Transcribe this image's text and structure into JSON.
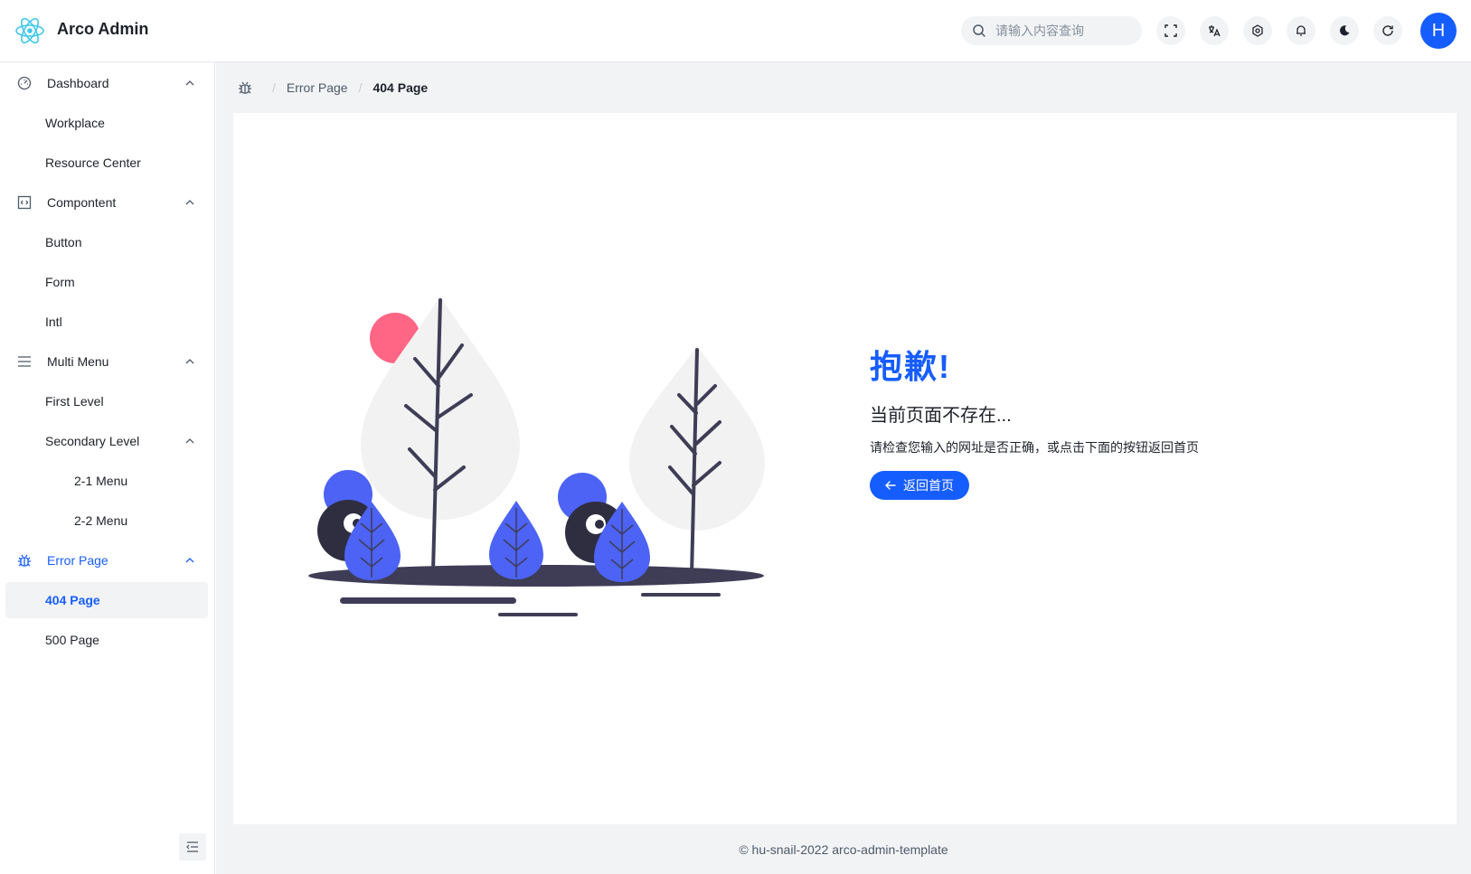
{
  "app": {
    "title": "Arco Admin"
  },
  "header": {
    "search_placeholder": "请输入内容查询",
    "avatar_letter": "H",
    "buttons": [
      "fullscreen-icon",
      "translate-icon",
      "settings-icon",
      "bell-icon",
      "moon-icon",
      "refresh-icon"
    ]
  },
  "sidebar": {
    "items": [
      {
        "label": "Dashboard",
        "icon": "dashboard-icon",
        "expanded": true
      },
      {
        "label": "Workplace"
      },
      {
        "label": "Resource Center"
      },
      {
        "label": "Compontent",
        "icon": "code-block-icon",
        "expanded": true
      },
      {
        "label": "Button"
      },
      {
        "label": "Form"
      },
      {
        "label": "Intl"
      },
      {
        "label": "Multi Menu",
        "icon": "menu-icon",
        "expanded": true
      },
      {
        "label": "First Level"
      },
      {
        "label": "Secondary Level",
        "expanded": true
      },
      {
        "label": "2-1 Menu"
      },
      {
        "label": "2-2 Menu"
      },
      {
        "label": "Error Page",
        "icon": "bug-icon",
        "expanded": true,
        "active": true
      },
      {
        "label": "404 Page",
        "selected": true
      },
      {
        "label": "500 Page"
      }
    ]
  },
  "breadcrumb": {
    "items": [
      "Error Page",
      "404 Page"
    ]
  },
  "error": {
    "title": "抱歉!",
    "subtitle": "当前页面不存在...",
    "description": "请检查您输入的网址是否正确，或点击下面的按钮返回首页",
    "button_label": "返回首页"
  },
  "footer": {
    "text": "© hu-snail-2022 arco-admin-template"
  },
  "colors": {
    "primary": "#165dff",
    "illustration_accent": "#4c63f5",
    "sun": "#ff6584",
    "dark": "#3f3d56"
  }
}
